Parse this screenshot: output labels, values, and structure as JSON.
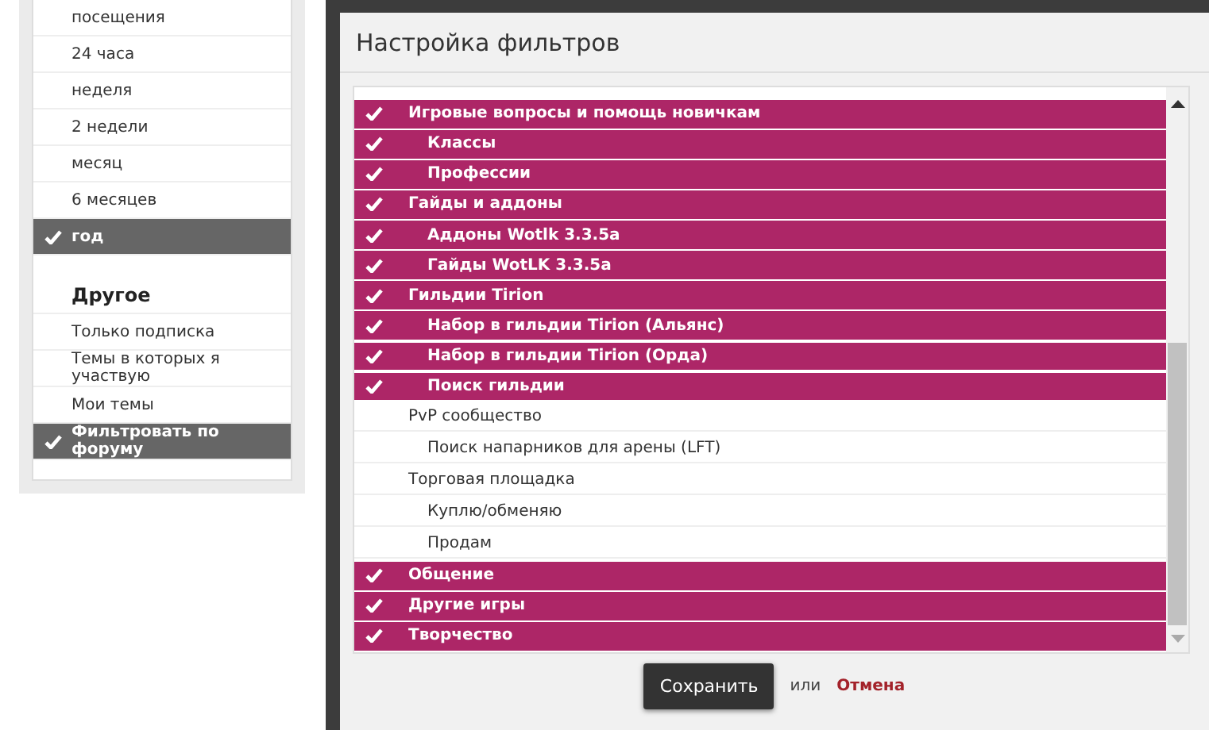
{
  "sidebar": {
    "groups": [
      {
        "items": [
          {
            "label": "посещения",
            "selected": false
          },
          {
            "label": "24 часа",
            "selected": false
          },
          {
            "label": "неделя",
            "selected": false
          },
          {
            "label": "2 недели",
            "selected": false
          },
          {
            "label": "месяц",
            "selected": false
          },
          {
            "label": "6 месяцев",
            "selected": false
          },
          {
            "label": "год",
            "selected": true
          }
        ]
      },
      {
        "title": "Другое",
        "items": [
          {
            "label": "Только подписка",
            "selected": false
          },
          {
            "label": "Темы в которых я участвую",
            "selected": false
          },
          {
            "label": "Мои темы",
            "selected": false
          },
          {
            "label": "Фильтровать по форуму",
            "selected": true
          }
        ]
      }
    ]
  },
  "dialog": {
    "title": "Настройка фильтров",
    "forums": [
      {
        "label": "Игровые вопросы и помощь новичкам",
        "checked": true,
        "children": [
          {
            "label": "Классы",
            "checked": true
          },
          {
            "label": "Профессии",
            "checked": true
          }
        ]
      },
      {
        "label": "Гайды и аддоны",
        "checked": true,
        "children": [
          {
            "label": "Аддоны Wotlk 3.3.5a",
            "checked": true
          },
          {
            "label": "Гайды WotLK 3.3.5a",
            "checked": true
          }
        ]
      },
      {
        "label": "Гильдии Tirion",
        "checked": true,
        "children": [
          {
            "label": "Набор в гильдии Tirion (Альянс)",
            "checked": true
          },
          {
            "label": "Набор в гильдии Tirion (Орда)",
            "checked": true
          },
          {
            "label": "Поиск гильдии",
            "checked": true
          }
        ]
      },
      {
        "label": "PvP сообщество",
        "checked": false,
        "children": [
          {
            "label": "Поиск напарников для арены (LFT)",
            "checked": false
          }
        ]
      },
      {
        "label": "Торговая площадка",
        "checked": false,
        "children": [
          {
            "label": "Куплю/обменяю",
            "checked": false
          },
          {
            "label": "Продам",
            "checked": false
          }
        ]
      },
      {
        "label": "Общение",
        "checked": true
      },
      {
        "label": "Другие игры",
        "checked": true
      },
      {
        "label": "Творчество",
        "checked": true
      }
    ],
    "save_button": "Сохранить",
    "or_text": "или",
    "cancel_link": "Отмена"
  }
}
